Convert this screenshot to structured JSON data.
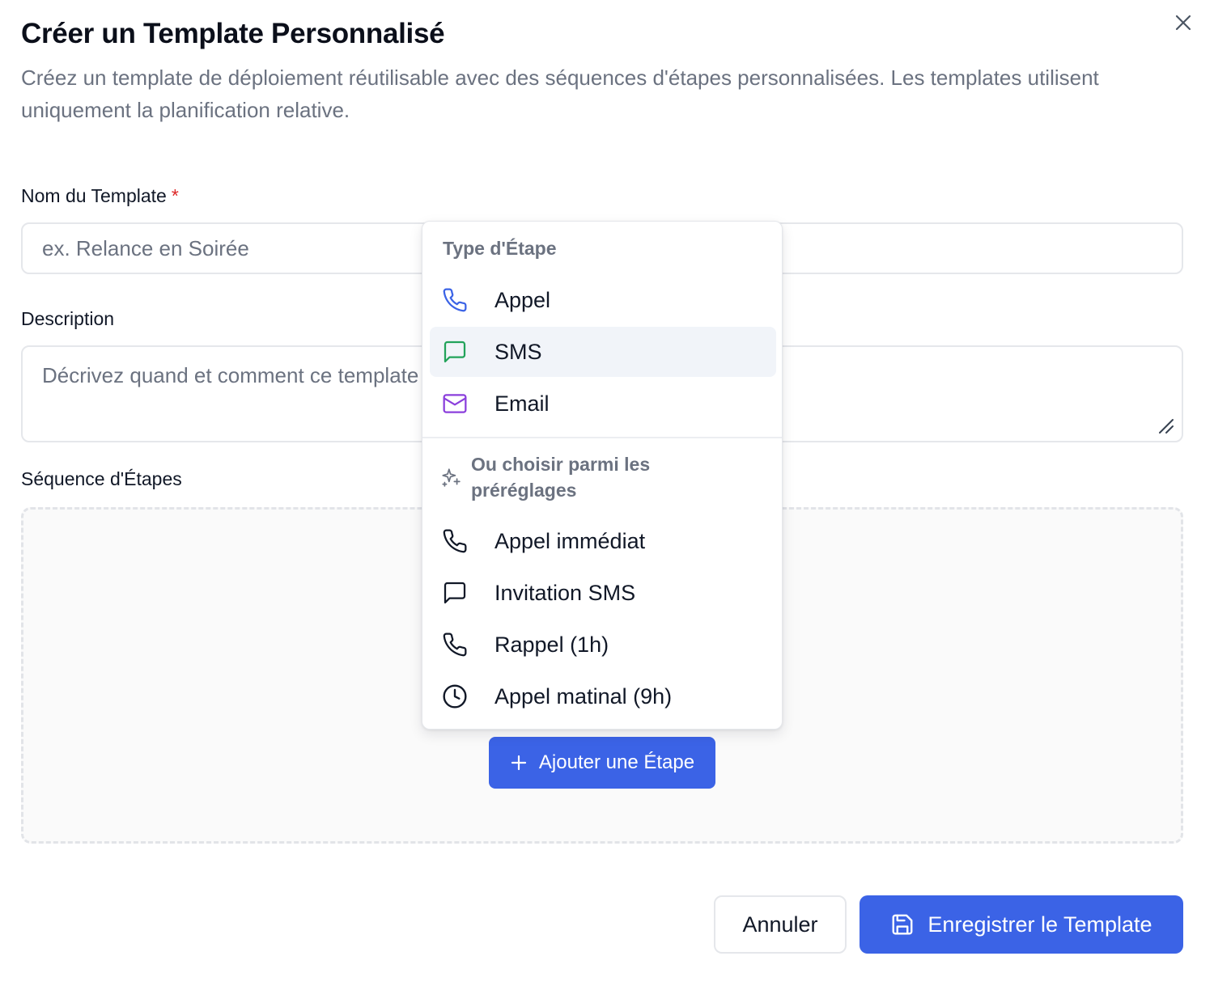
{
  "dialog": {
    "title": "Créer un Template Personnalisé",
    "subtitle": "Créez un template de déploiement réutilisable avec des séquences d'étapes personnalisées. Les templates utilisent uniquement la planification relative."
  },
  "form": {
    "name_label": "Nom du Template",
    "required_mark": "*",
    "name_placeholder": "ex. Relance en Soirée",
    "description_label": "Description",
    "description_placeholder": "Décrivez quand et comment ce template doit être utilisé...",
    "sequence_label": "Séquence d'Étapes",
    "add_step_label": "Ajouter une Étape"
  },
  "dropdown": {
    "heading": "Type d'Étape",
    "types": [
      {
        "label": "Appel",
        "icon": "phone-icon",
        "color": "#3b63e6"
      },
      {
        "label": "SMS",
        "icon": "message-icon",
        "color": "#22a35a"
      },
      {
        "label": "Email",
        "icon": "mail-icon",
        "color": "#8b3fdc"
      }
    ],
    "presets_heading": "Ou choisir parmi les préréglages",
    "presets": [
      {
        "label": "Appel immédiat",
        "icon": "phone-icon"
      },
      {
        "label": "Invitation SMS",
        "icon": "message-icon"
      },
      {
        "label": "Rappel (1h)",
        "icon": "phone-icon"
      },
      {
        "label": "Appel matinal (9h)",
        "icon": "clock-icon"
      }
    ]
  },
  "footer": {
    "cancel_label": "Annuler",
    "save_label": "Enregistrer le Template"
  },
  "colors": {
    "primary": "#3b63e6",
    "muted_text": "#6b7280",
    "required": "#dc2626"
  }
}
